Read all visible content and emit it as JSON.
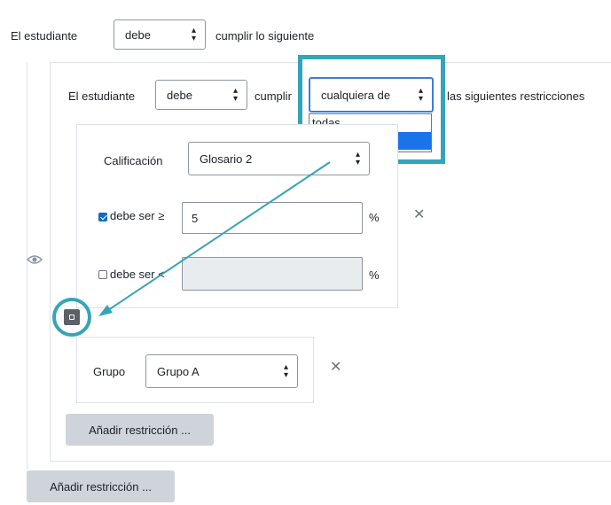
{
  "row1": {
    "prefix": "El estudiante",
    "select_value": "debe",
    "suffix": "cumplir lo siguiente"
  },
  "nested": {
    "prefix": "El estudiante",
    "select_value": "debe",
    "middle": "cumplir",
    "select2_value": "cualquiera de",
    "suffix": "las siguientes restricciones",
    "dropdown_options": [
      "todas",
      "cualquiera de"
    ],
    "selected_option": "cualquiera de"
  },
  "grade": {
    "label": "Calificación",
    "select_value": "Glosario 2",
    "min_label": "debe ser ≥",
    "min_checked": true,
    "min_value": "5",
    "max_label": "debe ser <",
    "max_checked": false,
    "max_value": "",
    "percent": "%"
  },
  "group": {
    "label": "Grupo",
    "select_value": "Grupo A"
  },
  "buttons": {
    "add_inner": "Añadir restricción ...",
    "add_outer": "Añadir restricción ..."
  },
  "icons": {
    "eye": "eye-icon",
    "close": "close-icon",
    "move": "move-icon",
    "caret": "sort-caret-icon"
  },
  "colors": {
    "annotation": "#35a4b8",
    "selected_option": "#1a73e8",
    "button": "#ced4da"
  }
}
